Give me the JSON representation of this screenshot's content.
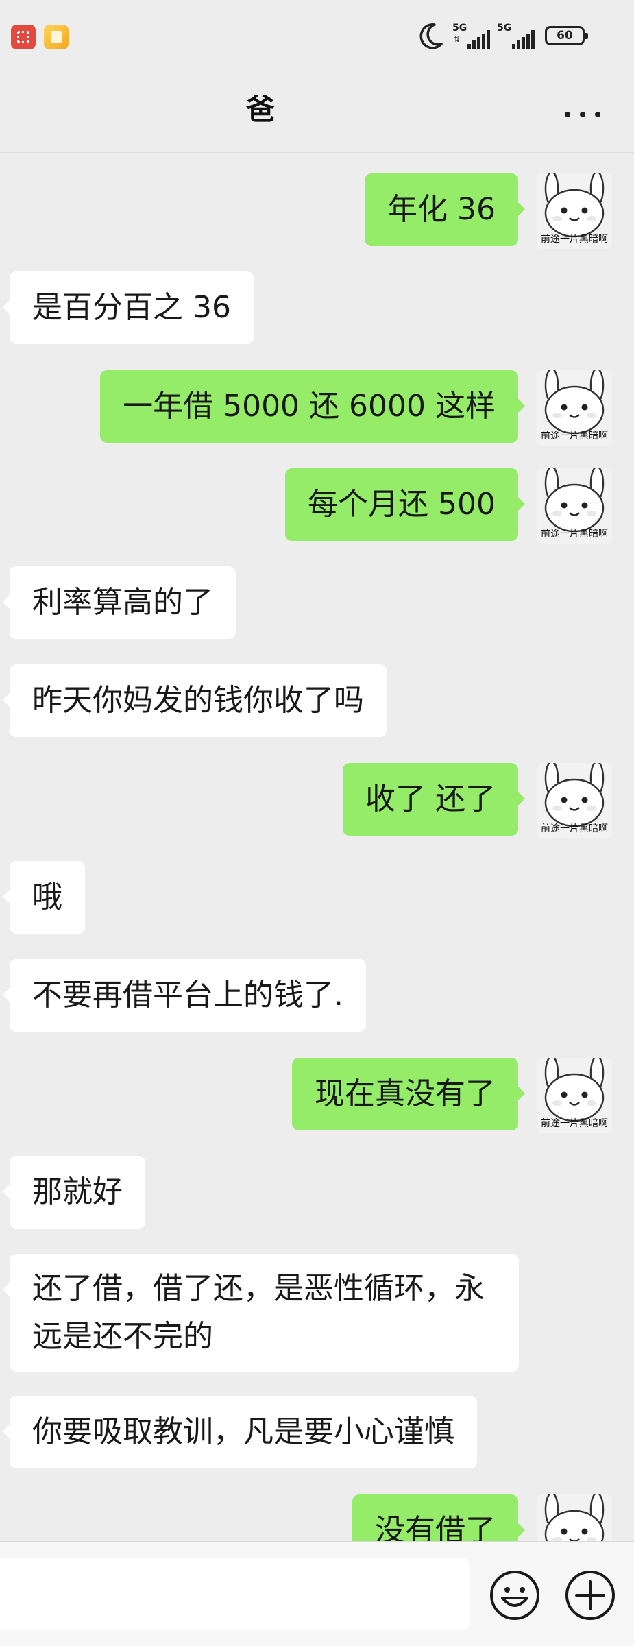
{
  "status_bar": {
    "network_1": "5G",
    "network_2": "5G",
    "battery": "60"
  },
  "header": {
    "title": "爸"
  },
  "avatar_caption": "前途一片黑暗啊",
  "messages": [
    {
      "side": "out",
      "text": "年化 36"
    },
    {
      "side": "in",
      "text": "是百分百之 36"
    },
    {
      "side": "out",
      "text": "一年借 5000 还 6000 这样"
    },
    {
      "side": "out",
      "text": "每个月还 500"
    },
    {
      "side": "in",
      "text": "利率算高的了"
    },
    {
      "side": "in",
      "text": "昨天你妈发的钱你收了吗"
    },
    {
      "side": "out",
      "text": "收了 还了"
    },
    {
      "side": "in",
      "text": "哦"
    },
    {
      "side": "in",
      "text": "不要再借平台上的钱了."
    },
    {
      "side": "out",
      "text": "现在真没有了"
    },
    {
      "side": "in",
      "text": "那就好"
    },
    {
      "side": "in",
      "text": "还了借，借了还，是恶性循环，永远是还不完的"
    },
    {
      "side": "in",
      "text": "你要吸取教训，凡是要小心谨慎"
    },
    {
      "side": "out",
      "text": "没有借了"
    }
  ],
  "input_bar": {
    "placeholder": ""
  },
  "colors": {
    "background": "#ededed",
    "outgoing_bubble": "#95ec69",
    "incoming_bubble": "#ffffff"
  },
  "icons": {
    "emoji_button": "emoji-icon",
    "more_button": "plus-circle-icon",
    "header_menu": "more-dots-icon",
    "dnd": "moon-icon"
  }
}
